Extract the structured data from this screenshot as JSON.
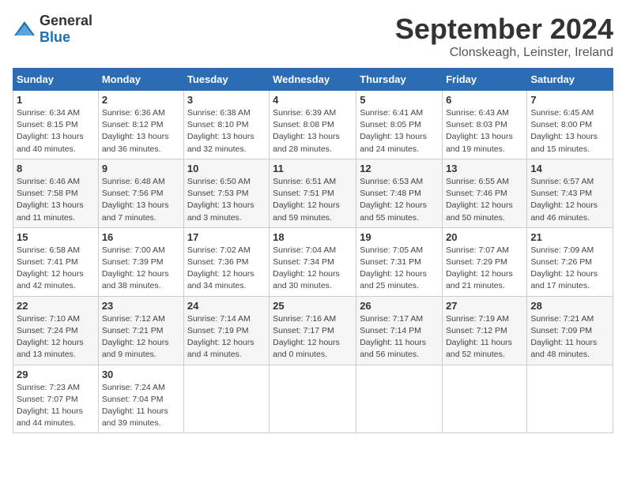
{
  "header": {
    "logo_general": "General",
    "logo_blue": "Blue",
    "month": "September 2024",
    "location": "Clonskeagh, Leinster, Ireland"
  },
  "days_of_week": [
    "Sunday",
    "Monday",
    "Tuesday",
    "Wednesday",
    "Thursday",
    "Friday",
    "Saturday"
  ],
  "weeks": [
    [
      {
        "day": "1",
        "sunrise": "Sunrise: 6:34 AM",
        "sunset": "Sunset: 8:15 PM",
        "daylight": "Daylight: 13 hours and 40 minutes."
      },
      {
        "day": "2",
        "sunrise": "Sunrise: 6:36 AM",
        "sunset": "Sunset: 8:12 PM",
        "daylight": "Daylight: 13 hours and 36 minutes."
      },
      {
        "day": "3",
        "sunrise": "Sunrise: 6:38 AM",
        "sunset": "Sunset: 8:10 PM",
        "daylight": "Daylight: 13 hours and 32 minutes."
      },
      {
        "day": "4",
        "sunrise": "Sunrise: 6:39 AM",
        "sunset": "Sunset: 8:08 PM",
        "daylight": "Daylight: 13 hours and 28 minutes."
      },
      {
        "day": "5",
        "sunrise": "Sunrise: 6:41 AM",
        "sunset": "Sunset: 8:05 PM",
        "daylight": "Daylight: 13 hours and 24 minutes."
      },
      {
        "day": "6",
        "sunrise": "Sunrise: 6:43 AM",
        "sunset": "Sunset: 8:03 PM",
        "daylight": "Daylight: 13 hours and 19 minutes."
      },
      {
        "day": "7",
        "sunrise": "Sunrise: 6:45 AM",
        "sunset": "Sunset: 8:00 PM",
        "daylight": "Daylight: 13 hours and 15 minutes."
      }
    ],
    [
      {
        "day": "8",
        "sunrise": "Sunrise: 6:46 AM",
        "sunset": "Sunset: 7:58 PM",
        "daylight": "Daylight: 13 hours and 11 minutes."
      },
      {
        "day": "9",
        "sunrise": "Sunrise: 6:48 AM",
        "sunset": "Sunset: 7:56 PM",
        "daylight": "Daylight: 13 hours and 7 minutes."
      },
      {
        "day": "10",
        "sunrise": "Sunrise: 6:50 AM",
        "sunset": "Sunset: 7:53 PM",
        "daylight": "Daylight: 13 hours and 3 minutes."
      },
      {
        "day": "11",
        "sunrise": "Sunrise: 6:51 AM",
        "sunset": "Sunset: 7:51 PM",
        "daylight": "Daylight: 12 hours and 59 minutes."
      },
      {
        "day": "12",
        "sunrise": "Sunrise: 6:53 AM",
        "sunset": "Sunset: 7:48 PM",
        "daylight": "Daylight: 12 hours and 55 minutes."
      },
      {
        "day": "13",
        "sunrise": "Sunrise: 6:55 AM",
        "sunset": "Sunset: 7:46 PM",
        "daylight": "Daylight: 12 hours and 50 minutes."
      },
      {
        "day": "14",
        "sunrise": "Sunrise: 6:57 AM",
        "sunset": "Sunset: 7:43 PM",
        "daylight": "Daylight: 12 hours and 46 minutes."
      }
    ],
    [
      {
        "day": "15",
        "sunrise": "Sunrise: 6:58 AM",
        "sunset": "Sunset: 7:41 PM",
        "daylight": "Daylight: 12 hours and 42 minutes."
      },
      {
        "day": "16",
        "sunrise": "Sunrise: 7:00 AM",
        "sunset": "Sunset: 7:39 PM",
        "daylight": "Daylight: 12 hours and 38 minutes."
      },
      {
        "day": "17",
        "sunrise": "Sunrise: 7:02 AM",
        "sunset": "Sunset: 7:36 PM",
        "daylight": "Daylight: 12 hours and 34 minutes."
      },
      {
        "day": "18",
        "sunrise": "Sunrise: 7:04 AM",
        "sunset": "Sunset: 7:34 PM",
        "daylight": "Daylight: 12 hours and 30 minutes."
      },
      {
        "day": "19",
        "sunrise": "Sunrise: 7:05 AM",
        "sunset": "Sunset: 7:31 PM",
        "daylight": "Daylight: 12 hours and 25 minutes."
      },
      {
        "day": "20",
        "sunrise": "Sunrise: 7:07 AM",
        "sunset": "Sunset: 7:29 PM",
        "daylight": "Daylight: 12 hours and 21 minutes."
      },
      {
        "day": "21",
        "sunrise": "Sunrise: 7:09 AM",
        "sunset": "Sunset: 7:26 PM",
        "daylight": "Daylight: 12 hours and 17 minutes."
      }
    ],
    [
      {
        "day": "22",
        "sunrise": "Sunrise: 7:10 AM",
        "sunset": "Sunset: 7:24 PM",
        "daylight": "Daylight: 12 hours and 13 minutes."
      },
      {
        "day": "23",
        "sunrise": "Sunrise: 7:12 AM",
        "sunset": "Sunset: 7:21 PM",
        "daylight": "Daylight: 12 hours and 9 minutes."
      },
      {
        "day": "24",
        "sunrise": "Sunrise: 7:14 AM",
        "sunset": "Sunset: 7:19 PM",
        "daylight": "Daylight: 12 hours and 4 minutes."
      },
      {
        "day": "25",
        "sunrise": "Sunrise: 7:16 AM",
        "sunset": "Sunset: 7:17 PM",
        "daylight": "Daylight: 12 hours and 0 minutes."
      },
      {
        "day": "26",
        "sunrise": "Sunrise: 7:17 AM",
        "sunset": "Sunset: 7:14 PM",
        "daylight": "Daylight: 11 hours and 56 minutes."
      },
      {
        "day": "27",
        "sunrise": "Sunrise: 7:19 AM",
        "sunset": "Sunset: 7:12 PM",
        "daylight": "Daylight: 11 hours and 52 minutes."
      },
      {
        "day": "28",
        "sunrise": "Sunrise: 7:21 AM",
        "sunset": "Sunset: 7:09 PM",
        "daylight": "Daylight: 11 hours and 48 minutes."
      }
    ],
    [
      {
        "day": "29",
        "sunrise": "Sunrise: 7:23 AM",
        "sunset": "Sunset: 7:07 PM",
        "daylight": "Daylight: 11 hours and 44 minutes."
      },
      {
        "day": "30",
        "sunrise": "Sunrise: 7:24 AM",
        "sunset": "Sunset: 7:04 PM",
        "daylight": "Daylight: 11 hours and 39 minutes."
      },
      null,
      null,
      null,
      null,
      null
    ]
  ]
}
